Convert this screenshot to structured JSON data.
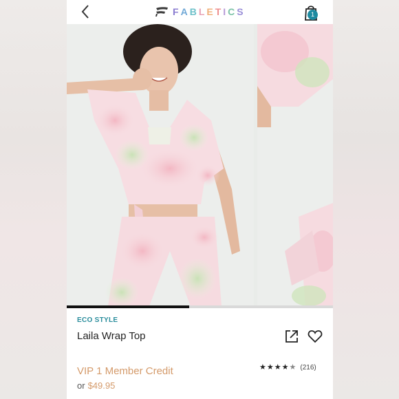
{
  "header": {
    "brand": "FABLETICS",
    "bag_count": "1"
  },
  "gallery": {
    "progress": 0.46
  },
  "product": {
    "eyebrow": "ECO STYLE",
    "name": "Laila Wrap Top",
    "vip_price": "VIP 1 Member Credit",
    "price_prefix": "or",
    "price": "$49.95",
    "rating_value": 4.5,
    "rating_count": "(216)"
  },
  "colors": {
    "accent_teal": "#2a8d9c",
    "price_orange": "#d49a6a",
    "badge": "#1e8aa0"
  },
  "icons": [
    "back-arrow-icon",
    "brand-logo-icon",
    "shopping-bag-icon",
    "share-icon",
    "heart-icon",
    "star-icon"
  ]
}
